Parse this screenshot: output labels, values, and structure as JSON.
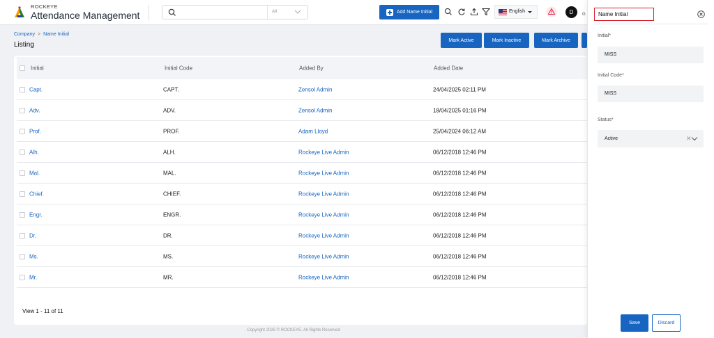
{
  "app": {
    "brand_small": "ROCKEYE",
    "brand_title": "Attendance Management"
  },
  "search": {
    "placeholder": "",
    "scope": "All"
  },
  "toolbar": {
    "add_label": "Add Name Initial",
    "language": "English",
    "avatar_initial": "D",
    "avatar_trailing": "G"
  },
  "breadcrumb": {
    "root": "Company",
    "separator": ">",
    "current": "Name Initial"
  },
  "page_title": "Listing",
  "actions": {
    "mark_active": "Mark Active",
    "mark_inactive": "Mark Inactive",
    "mark_archive": "Mark Archive"
  },
  "table": {
    "columns": [
      "Initial",
      "Initial Code",
      "Added By",
      "Added Date"
    ],
    "rows": [
      {
        "initial": "Capt.",
        "code": "CAPT.",
        "added_by": "Zensol Admin",
        "date": "24/04/2025 02:11 PM"
      },
      {
        "initial": "Adv.",
        "code": "ADV.",
        "added_by": "Zensol Admin",
        "date": "18/04/2025 01:16 PM"
      },
      {
        "initial": "Prof.",
        "code": "PROF.",
        "added_by": "Adam Lloyd",
        "date": "25/04/2024 06:12 AM"
      },
      {
        "initial": "Alh.",
        "code": "ALH.",
        "added_by": "Rockeye Live Admin",
        "date": "06/12/2018 12:46 PM"
      },
      {
        "initial": "Mal.",
        "code": "MAL.",
        "added_by": "Rockeye Live Admin",
        "date": "06/12/2018 12:46 PM"
      },
      {
        "initial": "Chief.",
        "code": "CHIEF.",
        "added_by": "Rockeye Live Admin",
        "date": "06/12/2018 12:46 PM"
      },
      {
        "initial": "Engr.",
        "code": "ENGR.",
        "added_by": "Rockeye Live Admin",
        "date": "06/12/2018 12:46 PM"
      },
      {
        "initial": "Dr.",
        "code": "DR.",
        "added_by": "Rockeye Live Admin",
        "date": "06/12/2018 12:46 PM"
      },
      {
        "initial": "Ms.",
        "code": "MS.",
        "added_by": "Rockeye Live Admin",
        "date": "06/12/2018 12:46 PM"
      },
      {
        "initial": "Mr.",
        "code": "MR.",
        "added_by": "Rockeye Live Admin",
        "date": "06/12/2018 12:46 PM"
      }
    ],
    "view_count": "View 1 - 11 of 11"
  },
  "footer": "Copyright 2025 © ROCKEYE. All Rights Reserved",
  "panel": {
    "title": "Name Initial",
    "initial_label": "Initial*",
    "initial_value": "MISS",
    "code_label": "Initial Code*",
    "code_value": "MISS",
    "status_label": "Status*",
    "status_value": "Active",
    "save_label": "Save",
    "discard_label": "Discard"
  },
  "colors": {
    "primary": "#1765c0",
    "highlight": "#d61f2c",
    "background": "#f0f1f4"
  },
  "icons": [
    "rockeye-logo-icon",
    "search-icon",
    "chevron-down-icon",
    "plus-icon",
    "refresh-icon",
    "upload-icon",
    "filter-icon",
    "us-flag-icon",
    "alert-icon",
    "close-circle-icon"
  ]
}
